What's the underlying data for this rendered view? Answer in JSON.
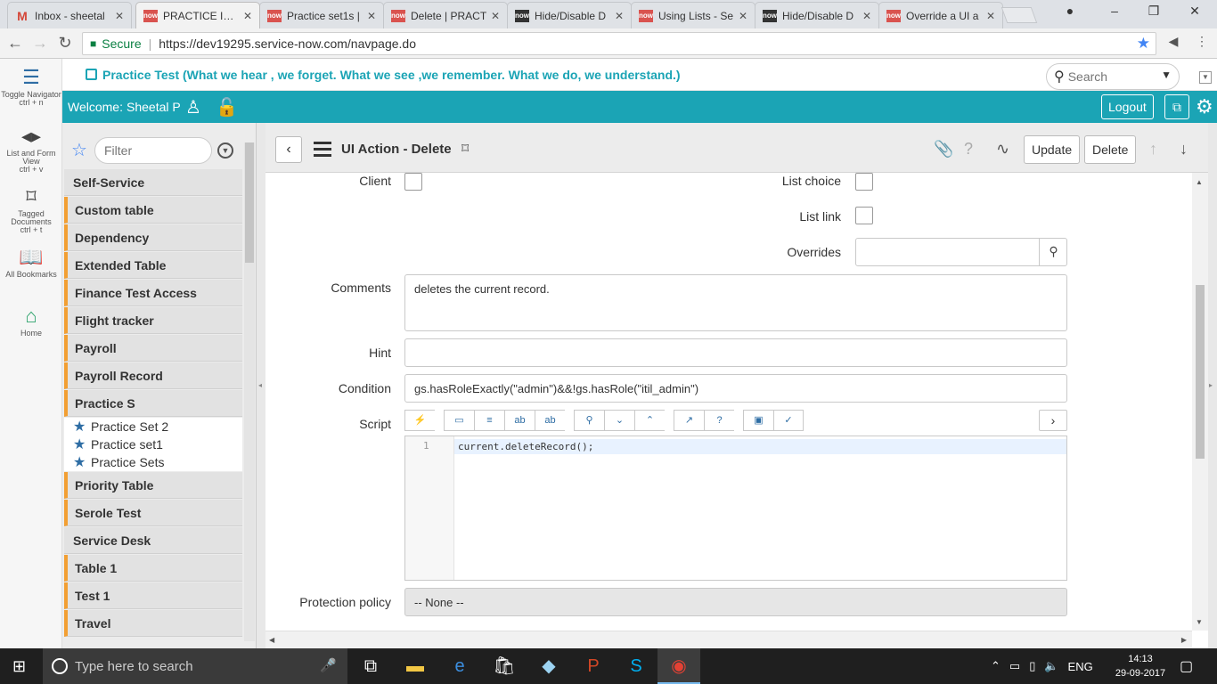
{
  "browser": {
    "tabs": [
      {
        "title": "Inbox - sheetal",
        "favicon": "gmail-icon"
      },
      {
        "title": "PRACTICE INST",
        "favicon": "now-icon"
      },
      {
        "title": "Practice set1s |",
        "favicon": "now-icon"
      },
      {
        "title": "Delete | PRACT",
        "favicon": "now-icon"
      },
      {
        "title": "Hide/Disable D",
        "favicon": "now-dark-icon"
      },
      {
        "title": "Using Lists - Se",
        "favicon": "now-icon"
      },
      {
        "title": "Hide/Disable D",
        "favicon": "now-dark-icon"
      },
      {
        "title": "Override a UI a",
        "favicon": "now-icon"
      }
    ],
    "active_tab": 1,
    "secure_label": "Secure",
    "url": "https://dev19295.service-now.com/navpage.do"
  },
  "left_nav": {
    "toggle": {
      "label": "Toggle Navigator",
      "shortcut": "ctrl + n"
    },
    "list_form": {
      "label": "List and Form View",
      "shortcut": "ctrl + v"
    },
    "tagged": {
      "label": "Tagged Documents",
      "shortcut": "ctrl + t"
    },
    "bookmarks": {
      "label": "All Bookmarks"
    },
    "home": {
      "label": "Home"
    }
  },
  "banner": {
    "title": "Practice Test (What we hear , we forget. What we see ,we remember. What we do, we understand.)",
    "search_placeholder": "Search"
  },
  "header": {
    "welcome": "Welcome:",
    "user": "Sheetal P",
    "logout": "Logout"
  },
  "filter": {
    "placeholder": "Filter",
    "modules": [
      {
        "label": "Self-Service",
        "orange": false
      },
      {
        "label": "Custom table",
        "orange": true
      },
      {
        "label": "Dependency",
        "orange": true
      },
      {
        "label": "Extended Table",
        "orange": true
      },
      {
        "label": "Finance Test Access",
        "orange": true
      },
      {
        "label": "Flight tracker",
        "orange": true
      },
      {
        "label": "Payroll",
        "orange": true
      },
      {
        "label": "Payroll Record",
        "orange": true
      },
      {
        "label": "Practice S",
        "orange": true
      }
    ],
    "favorites": [
      "Practice Set 2",
      "Practice set1",
      "Practice Sets"
    ],
    "modules_after": [
      {
        "label": "Priority Table",
        "orange": true
      },
      {
        "label": "Serole Test",
        "orange": true
      },
      {
        "label": "Service Desk",
        "orange": false
      },
      {
        "label": "Table 1",
        "orange": true
      },
      {
        "label": "Test 1",
        "orange": true
      },
      {
        "label": "Travel",
        "orange": true
      }
    ]
  },
  "form": {
    "title": "UI Action - Delete",
    "update_label": "Update",
    "delete_label": "Delete",
    "fields": {
      "client_label": "Client",
      "list_choice_label": "List choice",
      "list_link_label": "List link",
      "overrides_label": "Overrides",
      "comments_label": "Comments",
      "comments_value": "deletes the current record.",
      "hint_label": "Hint",
      "hint_value": "",
      "condition_label": "Condition",
      "condition_value": "gs.hasRoleExactly(\"admin\")&&!gs.hasRole(\"itil_admin\")",
      "script_label": "Script",
      "script_line_number": "1",
      "script_code": "current.deleteRecord();",
      "protection_label": "Protection policy",
      "protection_value": "-- None --"
    }
  },
  "taskbar": {
    "search_placeholder": "Type here to search",
    "lang": "ENG",
    "time": "14:13",
    "date": "29-09-2017"
  },
  "colors": {
    "accent": "#1ba4b5",
    "module_marker": "#f29f33"
  }
}
